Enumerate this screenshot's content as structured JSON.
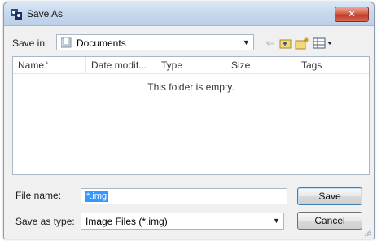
{
  "window": {
    "title": "Save As",
    "close_label": "✕"
  },
  "toolbar": {
    "save_in_label": "Save in:",
    "save_in_value": "Documents"
  },
  "file_list": {
    "columns": [
      "Name",
      "Date modif...",
      "Type",
      "Size",
      "Tags"
    ],
    "empty_message": "This folder is empty."
  },
  "form": {
    "file_name_label": "File name:",
    "file_name_value": "*.img",
    "save_as_type_label": "Save as type:",
    "save_as_type_value": "Image Files (*.img)"
  },
  "buttons": {
    "save": "Save",
    "cancel": "Cancel"
  },
  "colors": {
    "accent": "#3399ff",
    "close": "#c0392b"
  }
}
